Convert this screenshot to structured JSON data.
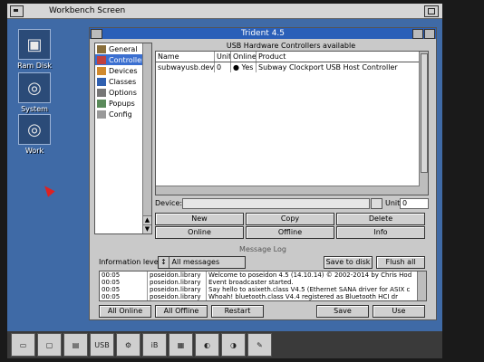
{
  "workbench": {
    "title": "Workbench Screen"
  },
  "desktop_icons": [
    {
      "label": "Ram Disk"
    },
    {
      "label": "System"
    },
    {
      "label": "Work"
    }
  ],
  "window": {
    "title": "Trident 4.5",
    "categories": [
      {
        "label": "General",
        "selected": false
      },
      {
        "label": "Controllers",
        "selected": true
      },
      {
        "label": "Devices",
        "selected": false
      },
      {
        "label": "Classes",
        "selected": false
      },
      {
        "label": "Options",
        "selected": false
      },
      {
        "label": "Popups",
        "selected": false
      },
      {
        "label": "Config",
        "selected": false
      }
    ],
    "group_title": "USB Hardware Controllers available",
    "table": {
      "columns": [
        "Name",
        "Unit",
        "Online",
        "Product"
      ],
      "rows": [
        {
          "name": "subwayusb.device",
          "unit": "0",
          "online": "Yes",
          "product": "Subway Clockport USB Host Controller"
        }
      ]
    },
    "device_label": "Device:",
    "device_value": "",
    "unit_label": "Unit:",
    "unit_value": "0",
    "buttons": {
      "new": "New",
      "copy": "Copy",
      "delete": "Delete",
      "online": "Online",
      "offline": "Offline",
      "info": "Info"
    },
    "log_header": "Message Log",
    "info_level_label": "Information level:",
    "info_level_value": "All messages",
    "save_to_disk": "Save to disk",
    "flush_all": "Flush all",
    "log": [
      {
        "time": "00:05",
        "source": "poseidon.library",
        "message": "Welcome to poseidon 4.5 (14.10.14) © 2002-2014 by Chris Hod"
      },
      {
        "time": "00:05",
        "source": "poseidon.library",
        "message": "Event broadcaster started."
      },
      {
        "time": "00:05",
        "source": "poseidon.library",
        "message": "Say hello to asixeth.class V4.5 (Ethernet SANA driver for ASIX c"
      },
      {
        "time": "00:05",
        "source": "poseidon.library",
        "message": "Whoah! bluetooth.class V4.4 registered as Bluetooth HCI dr"
      }
    ],
    "bottom": {
      "all_online": "All Online",
      "all_offline": "All Offline",
      "restart": "Restart",
      "save": "Save",
      "use": "Use"
    }
  },
  "taskbar": {
    "usb_label": "USB"
  }
}
